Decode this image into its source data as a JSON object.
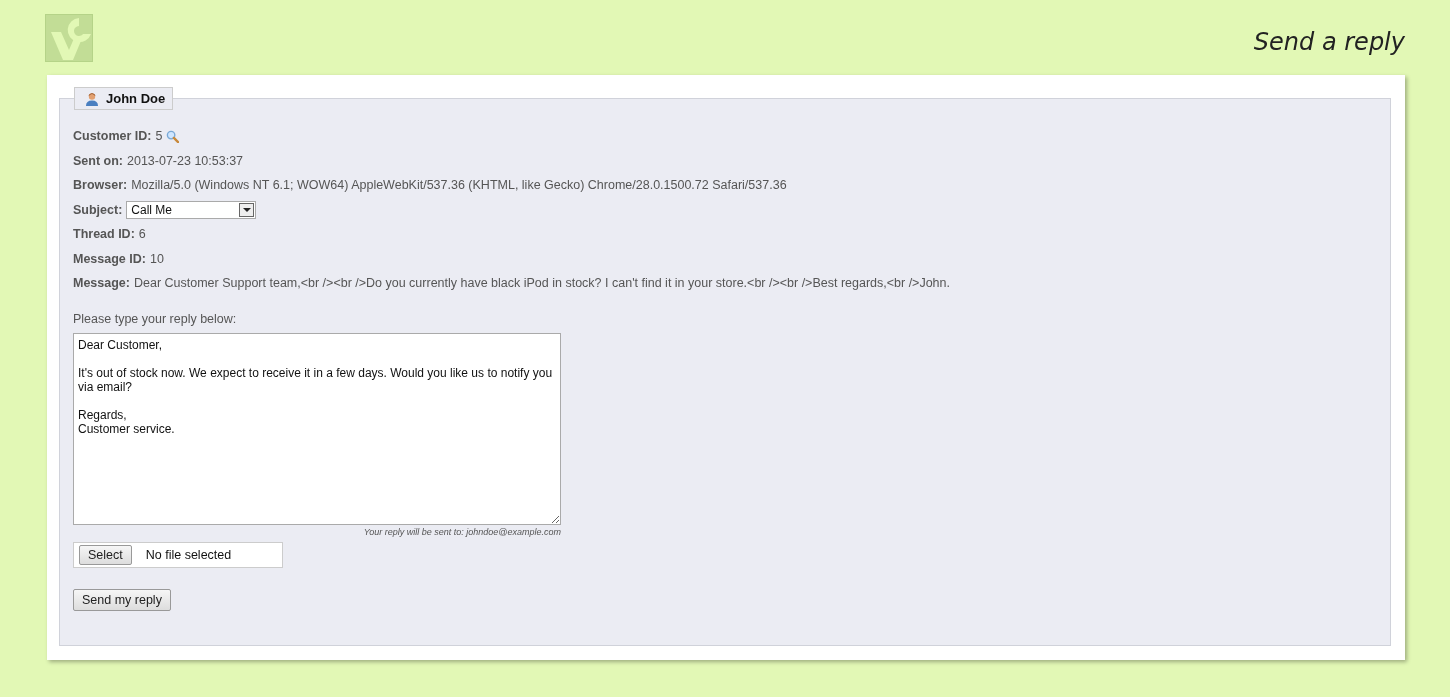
{
  "page_title": "Send a reply",
  "customer": {
    "name": "John Doe"
  },
  "fields": [
    {
      "kind": "lookup",
      "label": "Customer ID:",
      "value": "5"
    },
    {
      "kind": "text",
      "label": "Sent on:",
      "value": "2013-07-23 10:53:37"
    },
    {
      "kind": "text",
      "label": "Browser:",
      "value": "Mozilla/5.0 (Windows NT 6.1; WOW64) AppleWebKit/537.36 (KHTML, like Gecko) Chrome/28.0.1500.72 Safari/537.36"
    },
    {
      "kind": "select",
      "label": "Subject:",
      "value": "Call Me"
    },
    {
      "kind": "text",
      "label": "Thread ID:",
      "value": "6"
    },
    {
      "kind": "text",
      "label": "Message ID:",
      "value": "10"
    },
    {
      "kind": "text",
      "label": "Message:",
      "value": "Dear Customer Support team,<br /><br />Do you currently have black iPod in stock? I can't find it in your store.<br /><br />Best regards,<br />John."
    }
  ],
  "reply": {
    "prompt": "Please type your reply below:",
    "value": "Dear Customer,\n\nIt's out of stock now. We expect to receive it in a few days. Would you like us to notify you via email?\n\nRegards,\nCustomer service.",
    "note": "Your reply will be sent to: johndoe@example.com"
  },
  "file": {
    "button": "Select",
    "status": "No file selected"
  },
  "submit": "Send my reply"
}
